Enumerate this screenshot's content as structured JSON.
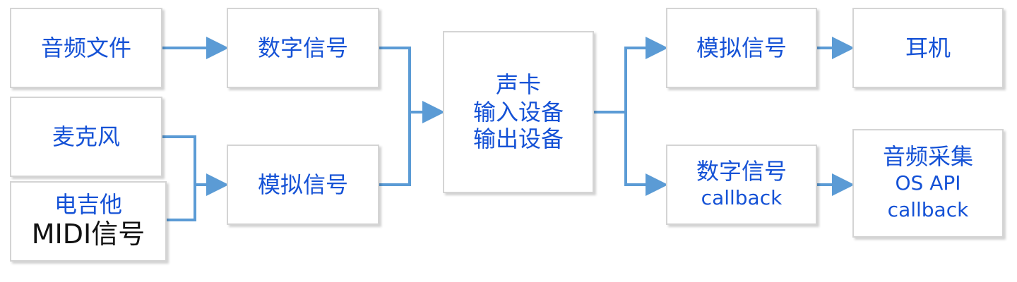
{
  "colors": {
    "text": "#1552d6",
    "text_secondary": "#111111",
    "arrow": "#5b9bd5",
    "box_border": "#d4d4d4"
  },
  "nodes": {
    "audio_file": {
      "lines": [
        "音频文件"
      ]
    },
    "microphone": {
      "lines": [
        "麦克风"
      ]
    },
    "guitar_midi": {
      "lines": [
        "电吉他",
        "MIDI信号"
      ]
    },
    "digital_signal_in": {
      "lines": [
        "数字信号"
      ]
    },
    "analog_signal_in": {
      "lines": [
        "模拟信号"
      ]
    },
    "sound_card": {
      "lines": [
        "声卡",
        "输入设备",
        "输出设备"
      ]
    },
    "analog_signal_out": {
      "lines": [
        "模拟信号"
      ]
    },
    "digital_signal_callback": {
      "lines": [
        "数字信号",
        "callback"
      ]
    },
    "headphones": {
      "lines": [
        "耳机"
      ]
    },
    "audio_capture": {
      "lines": [
        "音频采集",
        "OS API",
        "callback"
      ]
    }
  }
}
